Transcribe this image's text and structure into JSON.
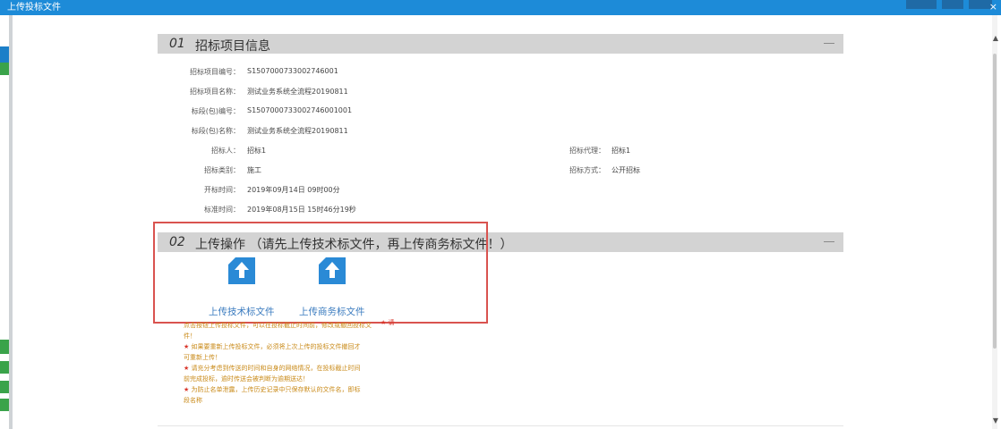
{
  "window": {
    "title": "上传投标文件",
    "close_glyph": "×"
  },
  "section1": {
    "number": "01",
    "title": "招标项目信息",
    "fields": [
      {
        "label": "招标项目编号：",
        "value": "S1507000733002746001"
      },
      {
        "label": "招标项目名称：",
        "value": "测试业务系统全流程20190811"
      },
      {
        "label": "标段(包)编号：",
        "value": "S1507000733002746001001"
      },
      {
        "label": "标段(包)名称：",
        "value": "测试业务系统全流程20190811"
      },
      {
        "label": "招标人：",
        "value": "招标1"
      },
      {
        "label": "招标类别：",
        "value": "施工"
      },
      {
        "label": "开标时间：",
        "value": "2019年09月14日 09时00分"
      },
      {
        "label": "标准时间：",
        "value": "2019年08月15日 15时46分19秒"
      }
    ],
    "right_fields": [
      {
        "label": "招标代理：",
        "value": "招标1"
      },
      {
        "label": "招标方式：",
        "value": "公开招标"
      }
    ]
  },
  "section2": {
    "number": "02",
    "title": "上传操作 （请先上传技术标文件，再上传商务标文件！）",
    "upload_technical_label": "上传技术标文件",
    "upload_business_label": "上传商务标文件"
  },
  "notes": {
    "top_fragment": "★ 请",
    "lines": [
      "点击按钮上传投标文件，可以在投标截止时间前，修改或撤回投标文",
      "件！",
      "★ 如果要重新上传投标文件，必须将上次上传的投标文件撤回才",
      "可重新上传！",
      "★ 请充分考虑到传送的时间和自身的网络情况，在投标截止时间",
      "前完成投标，逾时传送会被判断为逾期送达！",
      "★ 为防止名单泄露，上传历史记录中只保存默认的文件名，即标",
      "段名称"
    ]
  },
  "colors": {
    "accent": "#1d8bd8",
    "section_bar": "#d3d3d3",
    "upload_icon": "#2a8ad6",
    "highlight_border": "#d9534f",
    "note_text": "#c98a18",
    "note_star": "#d9362b"
  }
}
